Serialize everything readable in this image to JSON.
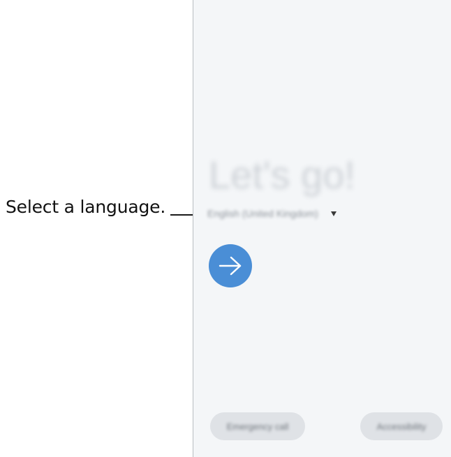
{
  "annotation": {
    "callout_text": "Select a language."
  },
  "setup_screen": {
    "greeting": "Let's go!",
    "language_select": {
      "selected_value": "English (United Kingdom)"
    },
    "next_button": {
      "icon": "arrow-right-icon"
    },
    "emergency_call_label": "Emergency call",
    "accessibility_label": "Accessibility"
  },
  "colors": {
    "accent": "#4a8ed6",
    "background": "#f4f6f8",
    "pill": "#dfe2e6"
  }
}
